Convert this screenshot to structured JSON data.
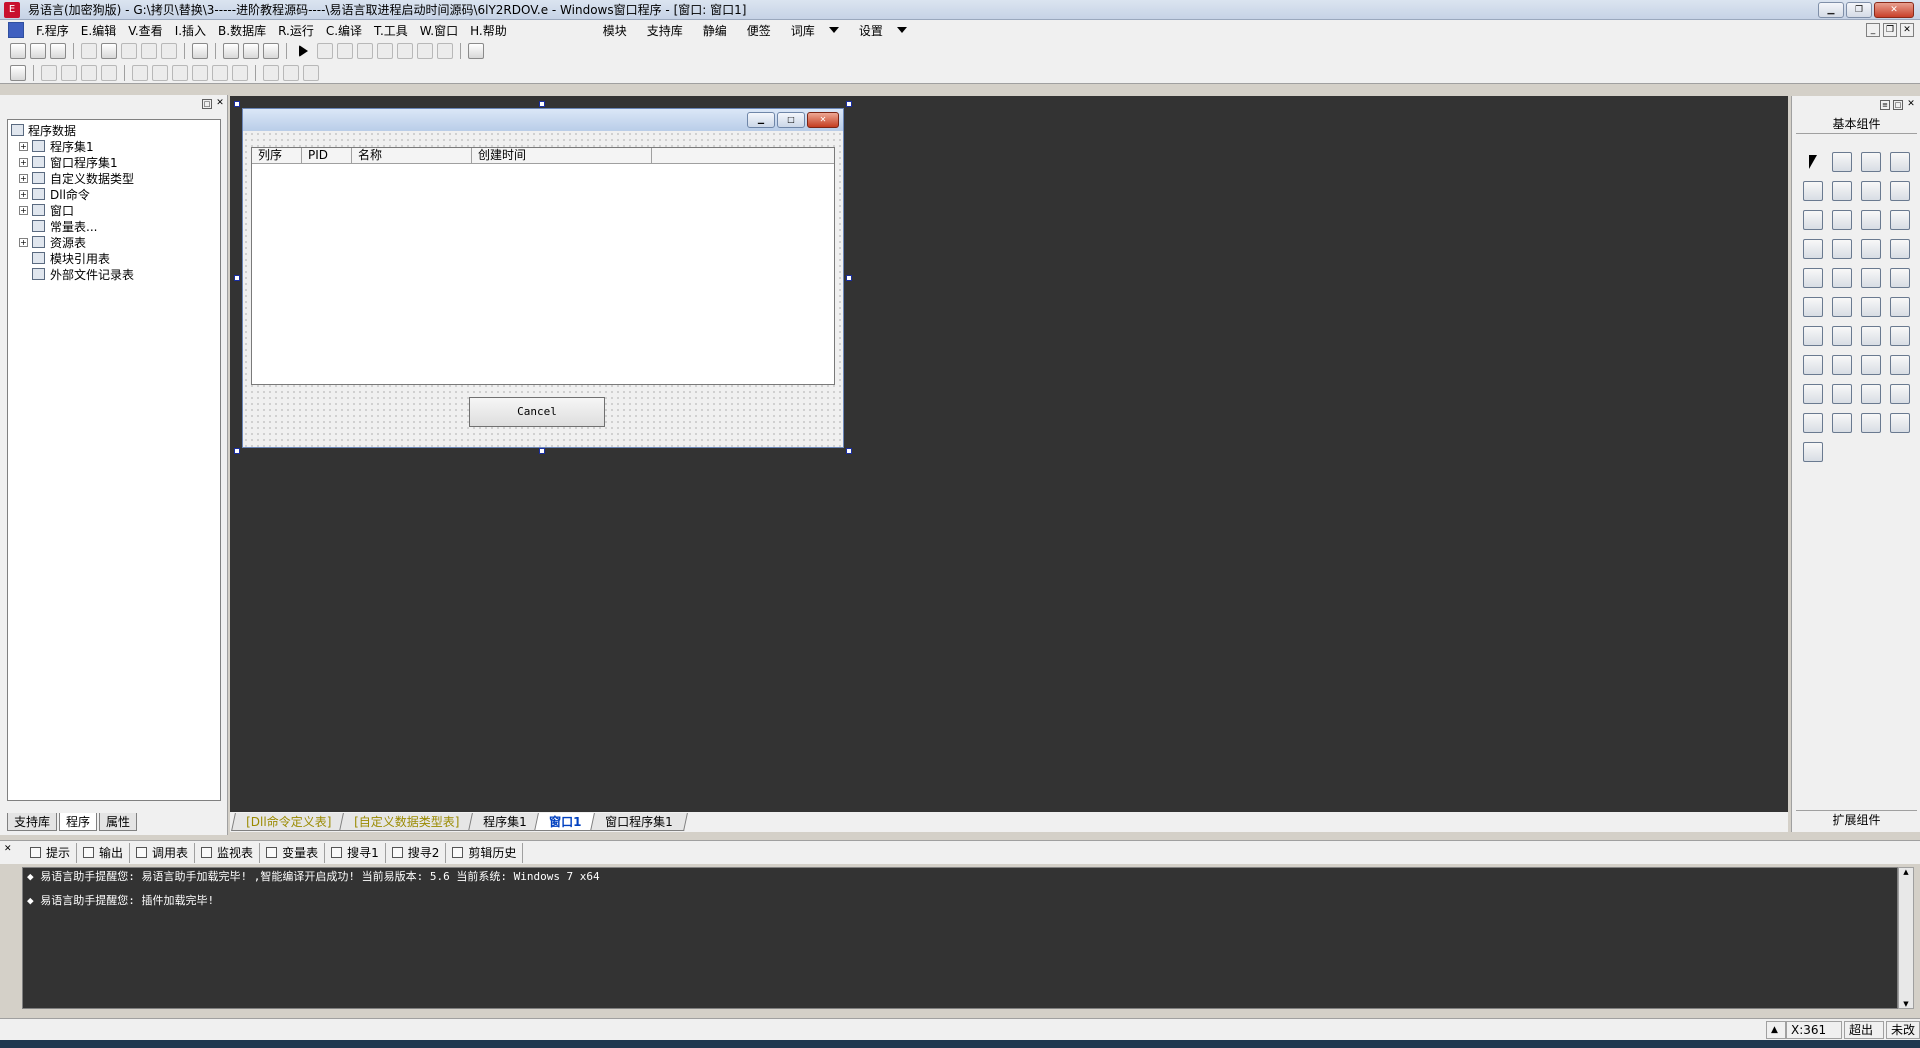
{
  "window": {
    "title": "易语言(加密狗版) - G:\\拷贝\\替换\\3-----进阶教程源码----\\易语言取进程启动时间源码\\6lY2RDOV.e - Windows窗口程序 - [窗口: 窗口1]"
  },
  "menu": {
    "items": [
      "F.程序",
      "E.编辑",
      "V.查看",
      "I.插入",
      "B.数据库",
      "R.运行",
      "C.编译",
      "T.工具",
      "W.窗口",
      "H.帮助"
    ],
    "extras": [
      "模块",
      "支持库",
      "静编",
      "便签",
      "词库",
      "设置"
    ]
  },
  "left_panel": {
    "root": "程序数据",
    "nodes": [
      "程序集1",
      "窗口程序集1",
      "自定义数据类型",
      "Dll命令",
      "窗口",
      "常量表...",
      "资源表"
    ],
    "leaves": [
      "模块引用表",
      "外部文件记录表"
    ],
    "tabs": [
      "支持库",
      "程序",
      "属性"
    ]
  },
  "form": {
    "listview_columns": [
      "列序",
      "PID",
      "名称",
      "创建时间"
    ],
    "cancel_label": "Cancel"
  },
  "design_tabs": [
    "[Dll命令定义表]",
    "[自定义数据类型表]",
    "程序集1",
    "窗口1",
    "窗口程序集1"
  ],
  "right_panel": {
    "title": "基本组件",
    "bottom": "扩展组件"
  },
  "output": {
    "tabs": [
      "提示",
      "输出",
      "调用表",
      "监视表",
      "变量表",
      "搜寻1",
      "搜寻2",
      "剪辑历史"
    ],
    "lines": [
      "◆ 易语言助手提醒您: 易语言助手加载完毕! ,智能编译开启成功! 当前易版本: 5.6 当前系统: Windows 7 x64",
      "◆ 易语言助手提醒您: 插件加载完毕!"
    ]
  },
  "status": {
    "coord": "X:361",
    "mode": "超出",
    "state": "未改"
  }
}
